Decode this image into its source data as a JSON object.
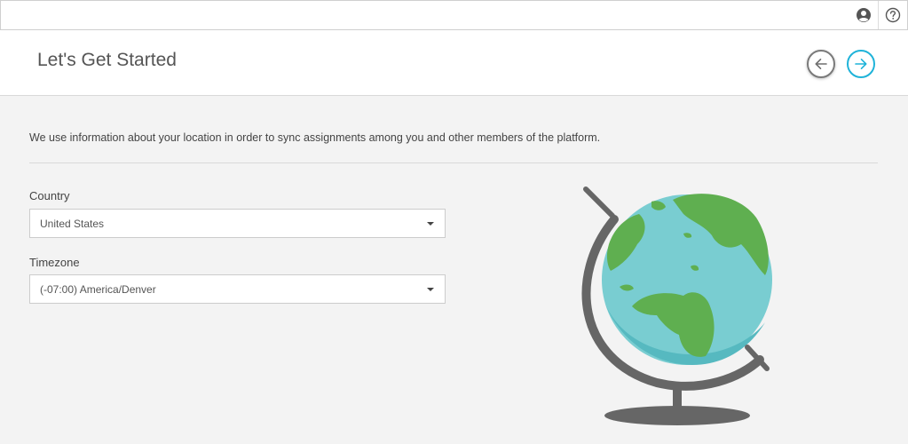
{
  "header": {
    "title": "Let's Get Started"
  },
  "intro": {
    "description": "We use information about your location in order to sync assignments among you and other members of the platform."
  },
  "form": {
    "country": {
      "label": "Country",
      "value": "United States"
    },
    "timezone": {
      "label": "Timezone",
      "value": "(-07:00) America/Denver"
    }
  },
  "icons": {
    "account": "user-circle-icon",
    "help": "help-circle-icon",
    "back": "arrow-left-icon",
    "next": "arrow-right-icon",
    "dropdown": "caret-down-icon",
    "illustration": "globe-illustration"
  },
  "colors": {
    "accent": "#1fb3d9",
    "ocean": "#79cdd1",
    "land": "#5faf50",
    "stand": "#666666"
  }
}
